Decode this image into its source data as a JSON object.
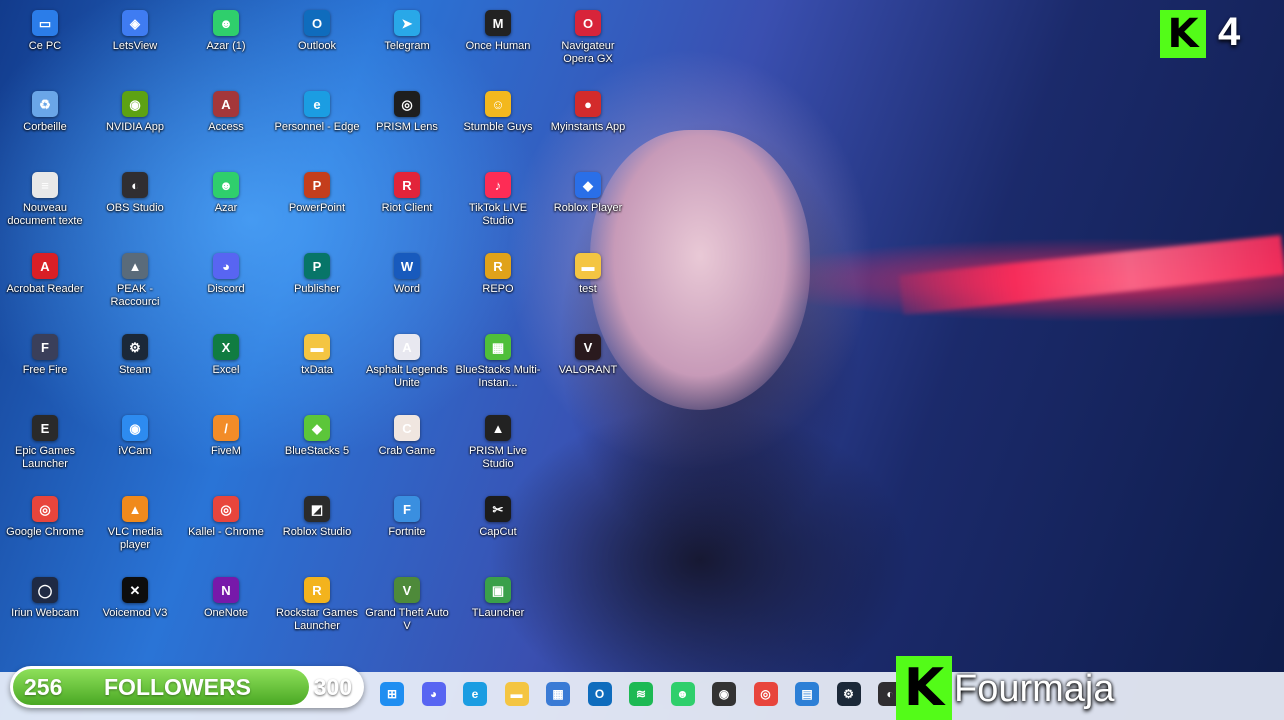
{
  "desktop": {
    "icons": [
      {
        "label": "Ce PC",
        "icon": "pc-icon",
        "color": "#2b7de9",
        "glyph": "▭"
      },
      {
        "label": "LetsView",
        "icon": "letsview-icon",
        "color": "#3f7cf2",
        "glyph": "◈"
      },
      {
        "label": "Azar (1)",
        "icon": "azar-icon",
        "color": "#2fcf6c",
        "glyph": "☻"
      },
      {
        "label": "Outlook",
        "icon": "outlook-icon",
        "color": "#0f6cbd",
        "glyph": "O"
      },
      {
        "label": "Telegram",
        "icon": "telegram-icon",
        "color": "#29a8e8",
        "glyph": "➤"
      },
      {
        "label": "Once Human",
        "icon": "once-human-icon",
        "color": "#222222",
        "glyph": "M"
      },
      {
        "label": "Navigateur Opera GX",
        "icon": "opera-gx-icon",
        "color": "#d8243a",
        "glyph": "O"
      },
      {
        "label": "Corbeille",
        "icon": "recycle-bin-icon",
        "color": "#6aa6e8",
        "glyph": "♻"
      },
      {
        "label": "NVIDIA App",
        "icon": "nvidia-icon",
        "color": "#5da213",
        "glyph": "◉"
      },
      {
        "label": "Access",
        "icon": "access-icon",
        "color": "#a4373a",
        "glyph": "A"
      },
      {
        "label": "Personnel - Edge",
        "icon": "edge-icon",
        "color": "#1b9de2",
        "glyph": "e"
      },
      {
        "label": "PRISM Lens",
        "icon": "prism-lens-icon",
        "color": "#1e1e1e",
        "glyph": "◎"
      },
      {
        "label": "Stumble Guys",
        "icon": "stumble-guys-icon",
        "color": "#f3b81e",
        "glyph": "☺"
      },
      {
        "label": "Myinstants App",
        "icon": "myinstants-icon",
        "color": "#d32b2b",
        "glyph": "●"
      },
      {
        "label": "Nouveau document texte",
        "icon": "text-document-icon",
        "color": "#e8e8e8",
        "glyph": "≡"
      },
      {
        "label": "OBS Studio",
        "icon": "obs-icon",
        "color": "#302e31",
        "glyph": "◐"
      },
      {
        "label": "Azar",
        "icon": "azar-icon",
        "color": "#2fcf6c",
        "glyph": "☻"
      },
      {
        "label": "PowerPoint",
        "icon": "powerpoint-icon",
        "color": "#c43e1c",
        "glyph": "P"
      },
      {
        "label": "Riot Client",
        "icon": "riot-client-icon",
        "color": "#e2243a",
        "glyph": "R"
      },
      {
        "label": "TikTok LIVE Studio",
        "icon": "tiktok-live-icon",
        "color": "#fe2c55",
        "glyph": "♪"
      },
      {
        "label": "Roblox Player",
        "icon": "roblox-icon",
        "color": "#2a6fe8",
        "glyph": "◆"
      },
      {
        "label": "Acrobat Reader",
        "icon": "acrobat-icon",
        "color": "#d91f26",
        "glyph": "A"
      },
      {
        "label": "PEAK - Raccourci",
        "icon": "peak-icon",
        "color": "#5a6b7a",
        "glyph": "▲"
      },
      {
        "label": "Discord",
        "icon": "discord-icon",
        "color": "#5865f2",
        "glyph": "◕"
      },
      {
        "label": "Publisher",
        "icon": "publisher-icon",
        "color": "#077568",
        "glyph": "P"
      },
      {
        "label": "Word",
        "icon": "word-icon",
        "color": "#185abd",
        "glyph": "W"
      },
      {
        "label": "REPO",
        "icon": "repo-icon",
        "color": "#e0a21a",
        "glyph": "R"
      },
      {
        "label": "test",
        "icon": "folder-icon",
        "color": "#f4c542",
        "glyph": "▬"
      },
      {
        "label": "Free Fire",
        "icon": "free-fire-icon",
        "color": "#3a3f5a",
        "glyph": "F"
      },
      {
        "label": "Steam",
        "icon": "steam-icon",
        "color": "#1b2838",
        "glyph": "⚙"
      },
      {
        "label": "Excel",
        "icon": "excel-icon",
        "color": "#107c41",
        "glyph": "X"
      },
      {
        "label": "txData",
        "icon": "folder-icon",
        "color": "#f4c542",
        "glyph": "▬"
      },
      {
        "label": "Asphalt Legends Unite",
        "icon": "asphalt-icon",
        "color": "#e8e8f0",
        "glyph": "A"
      },
      {
        "label": "BlueStacks Multi-Instan...",
        "icon": "bluestacks-multi-icon",
        "color": "#4fbf3a",
        "glyph": "▦"
      },
      {
        "label": "VALORANT",
        "icon": "valorant-icon",
        "color": "#2a1a1e",
        "glyph": "V"
      },
      {
        "label": "Epic Games Launcher",
        "icon": "epic-games-icon",
        "color": "#2a2a2a",
        "glyph": "E"
      },
      {
        "label": "iVCam",
        "icon": "ivcam-icon",
        "color": "#2d8bf0",
        "glyph": "◉"
      },
      {
        "label": "FiveM",
        "icon": "fivem-icon",
        "color": "#f28c28",
        "glyph": "/"
      },
      {
        "label": "BlueStacks 5",
        "icon": "bluestacks-icon",
        "color": "#5cc63a",
        "glyph": "◆"
      },
      {
        "label": "Crab Game",
        "icon": "crab-game-icon",
        "color": "#f0e6e0",
        "glyph": "C"
      },
      {
        "label": "PRISM Live Studio",
        "icon": "prism-live-icon",
        "color": "#222222",
        "glyph": "▲"
      },
      {
        "label": "Google Chrome",
        "icon": "chrome-icon",
        "color": "#e8453c",
        "glyph": "◎"
      },
      {
        "label": "VLC media player",
        "icon": "vlc-icon",
        "color": "#f08a1c",
        "glyph": "▲"
      },
      {
        "label": "Kallel - Chrome",
        "icon": "chrome-icon",
        "color": "#e8453c",
        "glyph": "◎"
      },
      {
        "label": "Roblox Studio",
        "icon": "roblox-studio-icon",
        "color": "#2b2b2b",
        "glyph": "◩"
      },
      {
        "label": "Fortnite",
        "icon": "fortnite-icon",
        "color": "#3a8fe0",
        "glyph": "F"
      },
      {
        "label": "CapCut",
        "icon": "capcut-icon",
        "color": "#1c1c1c",
        "glyph": "✂"
      },
      {
        "label": "Iriun Webcam",
        "icon": "iriun-icon",
        "color": "#1f2a44",
        "glyph": "◯"
      },
      {
        "label": "Voicemod V3",
        "icon": "voicemod-icon",
        "color": "#0d0d0d",
        "glyph": "✕"
      },
      {
        "label": "OneNote",
        "icon": "onenote-icon",
        "color": "#7719aa",
        "glyph": "N"
      },
      {
        "label": "Rockstar Games Launcher",
        "icon": "rockstar-icon",
        "color": "#f3b31d",
        "glyph": "R"
      },
      {
        "label": "Grand Theft Auto V",
        "icon": "gta-v-icon",
        "color": "#4e8a3a",
        "glyph": "V"
      },
      {
        "label": "TLauncher",
        "icon": "tlauncher-icon",
        "color": "#3aa04a",
        "glyph": "▣"
      }
    ]
  },
  "overlay": {
    "badge_letter": "K",
    "badge_number": "4",
    "followers_count": "256",
    "followers_caption": "FOLLOWERS",
    "followers_goal": "300",
    "followers_progress": 0.85,
    "streamer_letter": "K",
    "streamer_name": "Fourmaja"
  },
  "taskbar": {
    "icons": [
      {
        "icon": "windows-start-icon",
        "color": "#1f8ef1",
        "glyph": "⊞"
      },
      {
        "icon": "discord-icon",
        "color": "#5865f2",
        "glyph": "◕"
      },
      {
        "icon": "edge-icon",
        "color": "#1b9de2",
        "glyph": "e"
      },
      {
        "icon": "file-explorer-icon",
        "color": "#f4c542",
        "glyph": "▬"
      },
      {
        "icon": "microsoft-store-icon",
        "color": "#3a7bd5",
        "glyph": "▦"
      },
      {
        "icon": "outlook-icon",
        "color": "#0f6cbd",
        "glyph": "O"
      },
      {
        "icon": "spotify-icon",
        "color": "#1db954",
        "glyph": "≋"
      },
      {
        "icon": "azar-icon",
        "color": "#2fcf6c",
        "glyph": "☻"
      },
      {
        "icon": "webcam-icon",
        "color": "#333333",
        "glyph": "◉"
      },
      {
        "icon": "chrome-icon",
        "color": "#e8453c",
        "glyph": "◎"
      },
      {
        "icon": "photos-icon",
        "color": "#2c7fd6",
        "glyph": "▤"
      },
      {
        "icon": "steam-icon",
        "color": "#1b2838",
        "glyph": "⚙"
      },
      {
        "icon": "obs-icon",
        "color": "#302e31",
        "glyph": "◐"
      }
    ]
  }
}
